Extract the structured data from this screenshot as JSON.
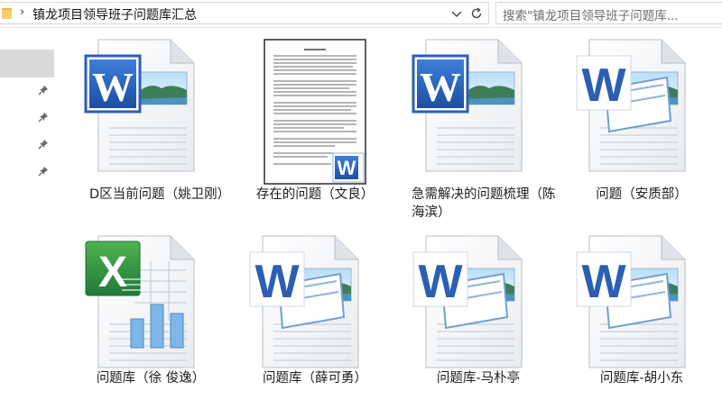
{
  "address": {
    "breadcrumb": "镇龙项目领导班子问题库汇总",
    "separator": "›"
  },
  "search": {
    "placeholder": "搜索\"镇龙项目领导班子问题库..."
  },
  "colors": {
    "word_blue": "#2b5fb3",
    "excel_green": "#1f7a3a",
    "nav_selected": "#d9d9d9",
    "pin": "#6a6a6a"
  },
  "files": [
    {
      "label": "D区当前问题（姚卫刚）",
      "type": "word-old",
      "icon": "word-doc-icon"
    },
    {
      "label": "存在的问题（文良）",
      "type": "word-thumbnail",
      "icon": "word-thumbnail-icon"
    },
    {
      "label": "急需解决的问题梳理（陈海滨）",
      "type": "word-old",
      "icon": "word-doc-icon"
    },
    {
      "label": "问题（安质部）",
      "type": "word-new",
      "icon": "word-docx-icon"
    },
    {
      "label": "问题库（徐 俊逸）",
      "type": "excel",
      "icon": "excel-xlsx-icon"
    },
    {
      "label": "问题库（薛可勇）",
      "type": "word-new",
      "icon": "word-docx-icon"
    },
    {
      "label": "问题库-马朴亭",
      "type": "word-new",
      "icon": "word-docx-icon"
    },
    {
      "label": "问题库-胡小东",
      "type": "word-new",
      "icon": "word-docx-icon"
    }
  ]
}
